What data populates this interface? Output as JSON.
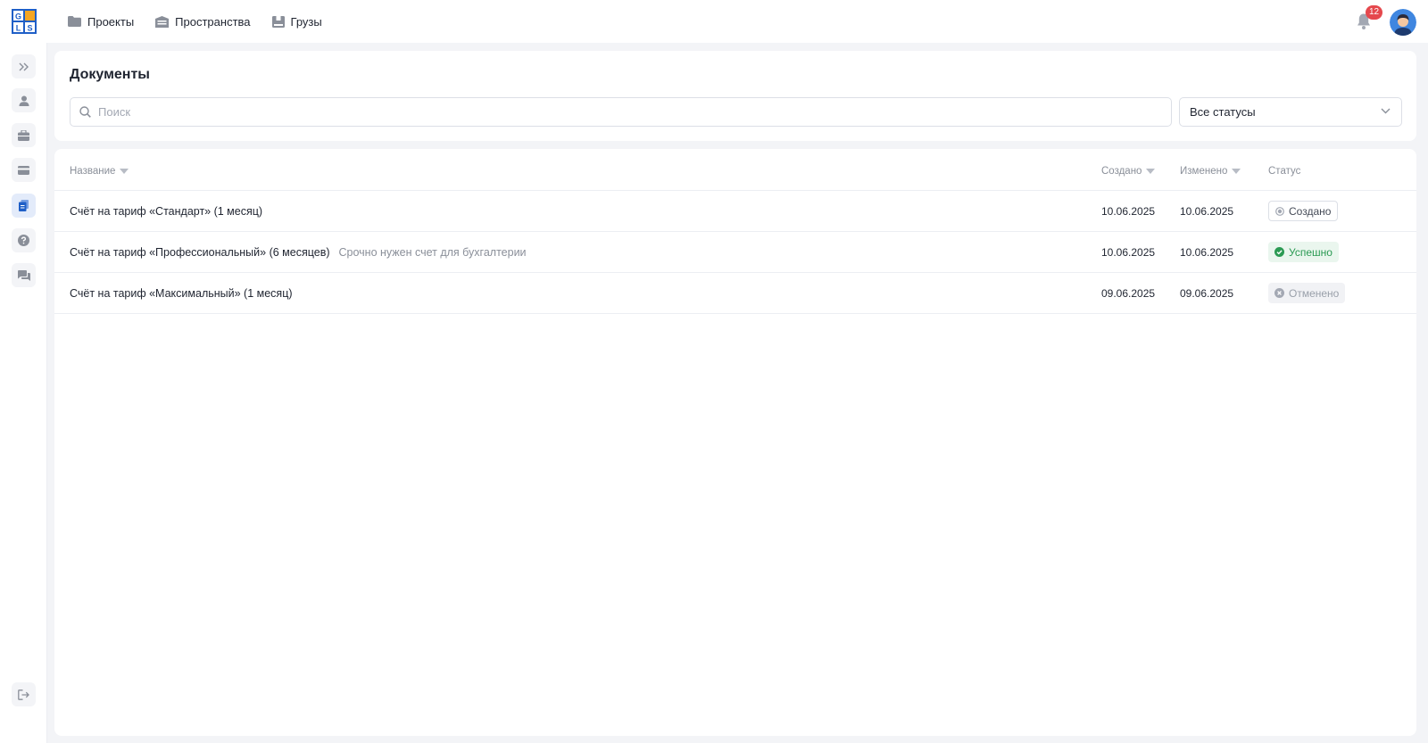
{
  "colors": {
    "accent": "#1f5fc7",
    "success": "#2b9a53",
    "danger": "#e5484d",
    "muted": "#8a8f99"
  },
  "logo": {
    "icon": "gls-logo",
    "text": "GLS"
  },
  "topnav": {
    "items": [
      {
        "label": "Проекты",
        "icon": "folder-icon"
      },
      {
        "label": "Пространства",
        "icon": "warehouse-icon"
      },
      {
        "label": "Грузы",
        "icon": "box-icon"
      }
    ],
    "notifications_count": "12"
  },
  "sidebar": {
    "items": [
      {
        "icon": "expand-icon"
      },
      {
        "icon": "user-icon"
      },
      {
        "icon": "briefcase-icon"
      },
      {
        "icon": "card-icon"
      },
      {
        "icon": "documents-icon",
        "active": true
      },
      {
        "icon": "help-icon"
      },
      {
        "icon": "chat-icon"
      },
      {
        "icon": "logout-icon"
      }
    ]
  },
  "page": {
    "title": "Документы",
    "search": {
      "placeholder": "Поиск",
      "value": ""
    },
    "status_filter": {
      "value": "Все статусы"
    }
  },
  "table": {
    "columns": {
      "name": "Название",
      "created": "Создано",
      "modified": "Изменено",
      "status": "Статус"
    },
    "rows": [
      {
        "name": "Счёт на тариф «Стандарт» (1 месяц)",
        "note": "",
        "created": "10.06.2025",
        "modified": "10.06.2025",
        "status": "Создано"
      },
      {
        "name": "Счёт на тариф «Профессиональный» (6 месяцев)",
        "note": "Срочно нужен счет для бухгалтерии",
        "created": "10.06.2025",
        "modified": "10.06.2025",
        "status": "Успешно"
      },
      {
        "name": "Счёт на тариф «Максимальный» (1 месяц)",
        "note": "",
        "created": "09.06.2025",
        "modified": "09.06.2025",
        "status": "Отменено"
      }
    ]
  }
}
